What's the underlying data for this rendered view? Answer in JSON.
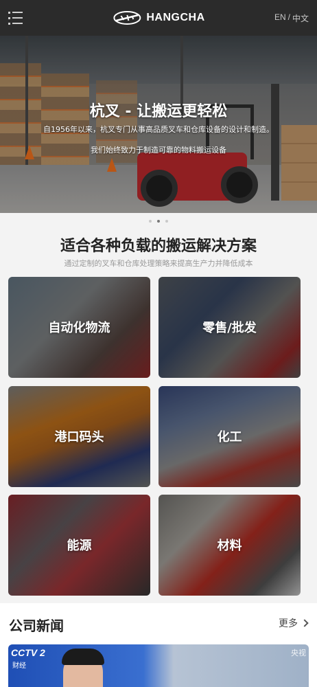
{
  "header": {
    "logo_text": "HANGCHA",
    "lang_en": "EN",
    "lang_sep": "/",
    "lang_zh": "中文"
  },
  "hero": {
    "title": "杭叉 - 让搬运更轻松",
    "subtitle1": "自1956年以来，杭叉专门从事高品质叉车和仓库设备的设计和制造。",
    "subtitle2": "我们始终致力于制造可靠的物料搬运设备",
    "slides_total": 3,
    "active_slide": 2
  },
  "solutions": {
    "title": "适合各种负载的搬运解决方案",
    "subtitle": "通过定制的叉车和仓库处理策略来提高生产力并降低成本",
    "cards": [
      {
        "label": "自动化物流"
      },
      {
        "label": "零售/批发"
      },
      {
        "label": "港口码头"
      },
      {
        "label": "化工"
      },
      {
        "label": "能源"
      },
      {
        "label": "材料"
      }
    ]
  },
  "news": {
    "title": "公司新闻",
    "more": "更多",
    "thumb": {
      "channel": "CCTV 2",
      "channel_sub": "财经",
      "watermark": "央视"
    }
  },
  "colors": {
    "header_bg": "#2b2b2b",
    "page_bg": "#f3f3f3",
    "title_text": "#222222",
    "subtitle_text": "#999999"
  }
}
